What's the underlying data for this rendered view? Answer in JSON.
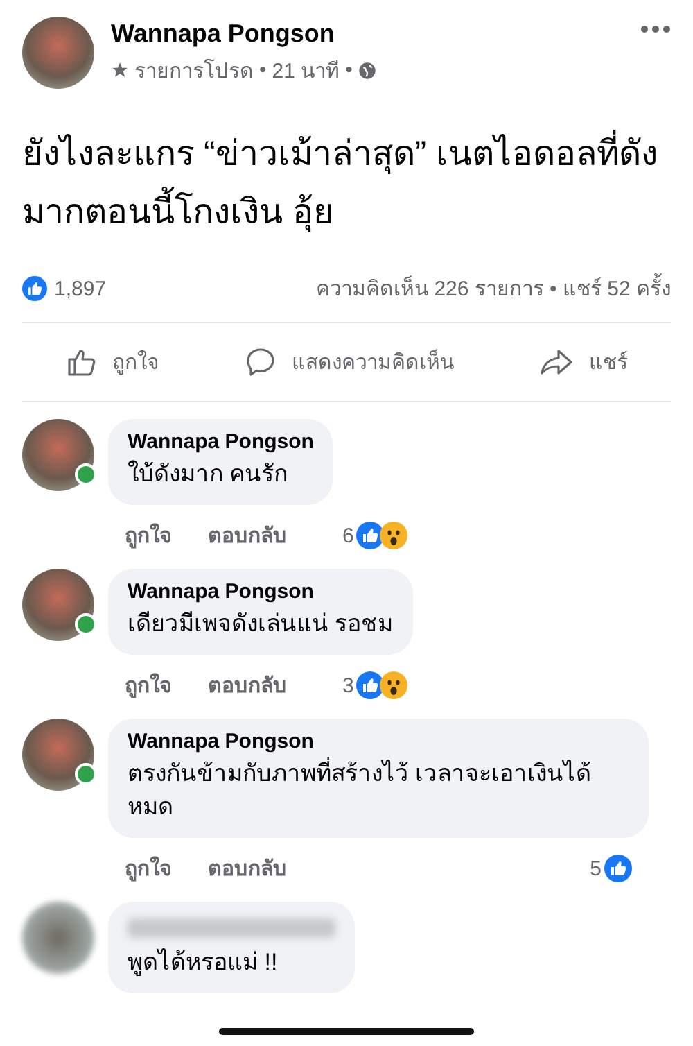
{
  "post": {
    "author": "Wannapa Pongson",
    "meta": [
      "รายการโปรด",
      "21 นาที"
    ],
    "meta_separator": "•",
    "text": "ยังไงละแกร “ข่าวเม้าล่าสุด” เนตไอดอลที่ดังมากตอนนี้โกงเงิน อุ้ย",
    "likes": "1,897",
    "stats": "ความคิดเห็น 226 รายการ • แชร์ 52 ครั้ง"
  },
  "actions": [
    {
      "kind": "like",
      "label": "ถูกใจ"
    },
    {
      "kind": "comment",
      "label": "แสดงความคิดเห็น"
    },
    {
      "kind": "share",
      "label": "แชร์"
    }
  ],
  "comments": [
    {
      "author": "Wannapa Pongson",
      "author_blurred": false,
      "online": true,
      "text": "ใบ้ดังมาก คนรัก",
      "like_label": "ถูกใจ",
      "reply_label": "ตอบกลับ",
      "count": "6",
      "reactions": [
        {
          "kind": "like"
        },
        {
          "kind": "wow"
        }
      ]
    },
    {
      "author": "Wannapa Pongson",
      "author_blurred": false,
      "online": true,
      "text": "เดียวมีเพจดังเล่นแน่ รอชม",
      "like_label": "ถูกใจ",
      "reply_label": "ตอบกลับ",
      "count": "3",
      "reactions": [
        {
          "kind": "like"
        },
        {
          "kind": "wow"
        }
      ]
    },
    {
      "author": "Wannapa Pongson",
      "author_blurred": false,
      "online": true,
      "text": "ตรงกันข้ามกับภาพที่สร้างไว้ เวลาจะเอาเงินได้หมด",
      "like_label": "ถูกใจ",
      "reply_label": "ตอบกลับ",
      "count": "5",
      "reactions": [
        {
          "kind": "like"
        }
      ]
    },
    {
      "author_blurred": true,
      "online": false,
      "text": "พูดได้หรอแม่ !!"
    }
  ]
}
